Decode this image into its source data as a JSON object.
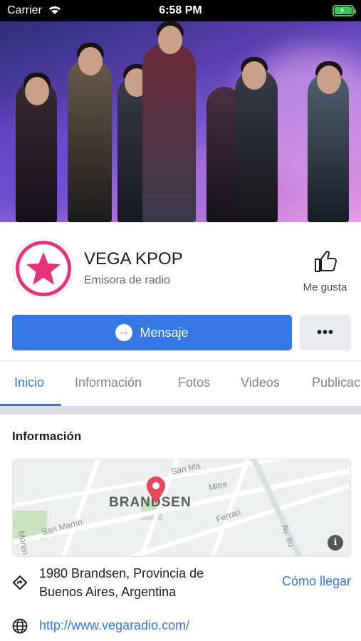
{
  "status_bar": {
    "carrier": "Carrier",
    "time": "6:58 PM"
  },
  "page": {
    "name": "VEGA KPOP",
    "category": "Emisora de radio",
    "like_label": "Me gusta"
  },
  "actions": {
    "message_label": "Mensaje",
    "more_label": "•••"
  },
  "tabs": [
    {
      "label": "Inicio",
      "active": true
    },
    {
      "label": "Información",
      "active": false
    },
    {
      "label": "Fotos",
      "active": false
    },
    {
      "label": "Videos",
      "active": false
    },
    {
      "label": "Publicaciones",
      "active": false
    }
  ],
  "info": {
    "title": "Información",
    "map": {
      "city_label": "BRANDSEN",
      "streets": [
        "San Martín",
        "San Ma",
        "Mitre",
        "Ferrari",
        "Av. Itu",
        "Moren"
      ]
    },
    "address": "1980 Brandsen, Provincia de Buenos Aires, Argentina",
    "directions_label": "Cómo llegar",
    "website": "http://www.vegaradio.com/"
  },
  "colors": {
    "accent": "#3578e5",
    "brand_pink": "#e7337c",
    "battery": "#35c759"
  }
}
